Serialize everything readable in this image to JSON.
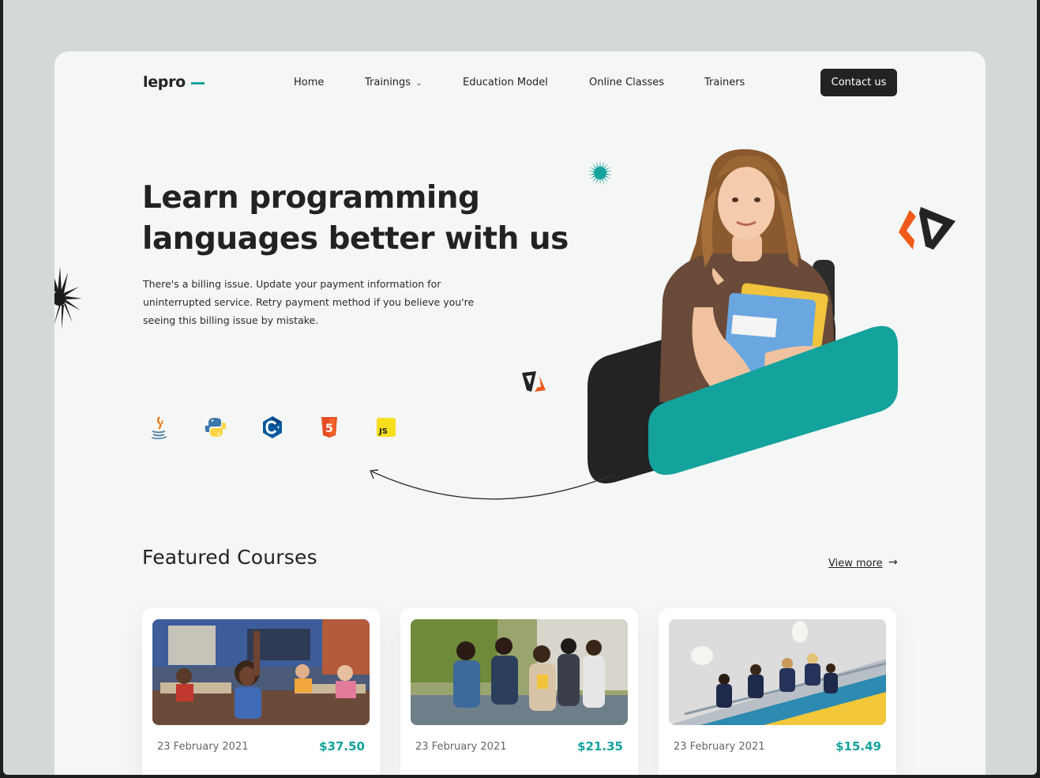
{
  "brand": {
    "logo_text": "lepro",
    "accent_color": "#14a29c",
    "dark_color": "#212322",
    "orange_color": "#f05a1a"
  },
  "nav": {
    "items": [
      {
        "label": "Home"
      },
      {
        "label": "Trainings",
        "has_dropdown": true
      },
      {
        "label": "Education Model"
      },
      {
        "label": "Online Classes"
      },
      {
        "label": "Trainers"
      }
    ],
    "cta_label": "Contact us"
  },
  "hero": {
    "title_line1": "Learn programming",
    "title_line2": "languages better with us",
    "desc_line1": "There's a billing issue. Update your payment information for",
    "desc_line2": "uninterrupted service.  Retry payment method if you believe you're",
    "desc_line3": "seeing this billing issue by mistake.",
    "languages": [
      {
        "name": "java-icon"
      },
      {
        "name": "python-icon"
      },
      {
        "name": "cplusplus-icon"
      },
      {
        "name": "html5-icon",
        "text": "5"
      },
      {
        "name": "javascript-icon",
        "text": "JS"
      }
    ]
  },
  "featured": {
    "title": "Featured Courses",
    "view_more": "View more",
    "courses": [
      {
        "date": "23 February 2021",
        "price": "$37.50",
        "image": "classroom-photo"
      },
      {
        "date": "23 February 2021",
        "price": "$21.35",
        "image": "students-outdoor-photo"
      },
      {
        "date": "23 February 2021",
        "price": "$15.49",
        "image": "students-stairs-photo"
      }
    ]
  }
}
